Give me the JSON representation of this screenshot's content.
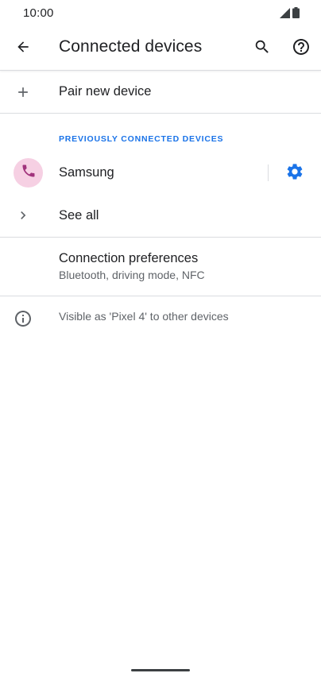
{
  "status_bar": {
    "time": "10:00",
    "icons": [
      "signal-icon",
      "battery-icon"
    ]
  },
  "app_bar": {
    "title": "Connected devices",
    "icons": [
      "back-arrow-icon",
      "search-icon",
      "help-icon"
    ]
  },
  "pair_new": {
    "label": "Pair new device",
    "icon": "plus-icon"
  },
  "previously_connected": {
    "header": "PREVIOUSLY CONNECTED DEVICES",
    "devices": [
      {
        "name": "Samsung",
        "icon": "phone-icon",
        "action_icon": "gear-icon"
      }
    ],
    "see_all_label": "See all",
    "see_all_icon": "chevron-right-icon"
  },
  "connection_preferences": {
    "title": "Connection preferences",
    "subtitle": "Bluetooth, driving mode, NFC"
  },
  "footer": {
    "text": "Visible as 'Pixel 4' to other devices",
    "icon": "info-icon"
  },
  "colors": {
    "accent": "#1a73e8",
    "avatar_bg": "#f6d0e3",
    "avatar_icon": "#a1337c",
    "text_primary": "#202124",
    "text_secondary": "#5f6368",
    "divider": "#dadce0"
  }
}
